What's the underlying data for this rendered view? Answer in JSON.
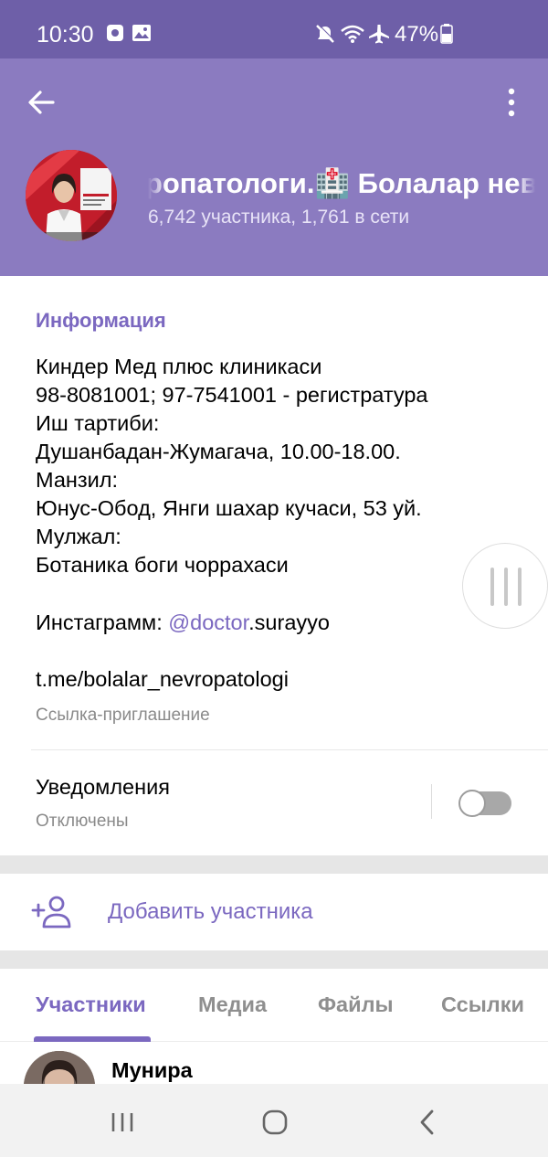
{
  "status_bar": {
    "time": "10:30",
    "battery": "47%",
    "icons": [
      "notification-icon",
      "gallery-icon",
      "mute-icon",
      "wifi-icon",
      "airplane-icon",
      "battery-icon"
    ]
  },
  "header": {
    "title": "Болалар невропатологи.🏥   Болалар невропатологи.🏥",
    "subtitle": "6,742 участника, 1,761 в сети"
  },
  "info": {
    "section_title": "Информация",
    "description_lines": [
      "Киндер Мед плюс клиникаси",
      "98-8081001; 97-7541001 - регистратура",
      "Иш тартиби:",
      "Душанбадан-Жумагача, 10.00-18.00.",
      "Манзил:",
      "Юнус-Обод, Янги шахар кучаси, 53 уй.",
      "Мулжал:",
      "Ботаника боги чоррахаси"
    ],
    "instagram_prefix": "Инстаграмм: ",
    "instagram_mention": "@doctor",
    "instagram_suffix": ".surayyo",
    "invite_link": "t.me/bolalar_nevropatologi",
    "invite_label": "Ссылка-приглашение",
    "notifications_label": "Уведомления",
    "notifications_state": "Отключены",
    "notifications_on": false
  },
  "add_member": {
    "label": "Добавить участника"
  },
  "tabs": [
    {
      "label": "Участники",
      "active": true
    },
    {
      "label": "Медиа",
      "active": false
    },
    {
      "label": "Файлы",
      "active": false
    },
    {
      "label": "Ссылки",
      "active": false
    }
  ],
  "members": [
    {
      "name": "Мунира"
    }
  ],
  "colors": {
    "header": "#8b7bc0",
    "status_bar": "#6e5fa8",
    "accent": "#7b68c0"
  }
}
